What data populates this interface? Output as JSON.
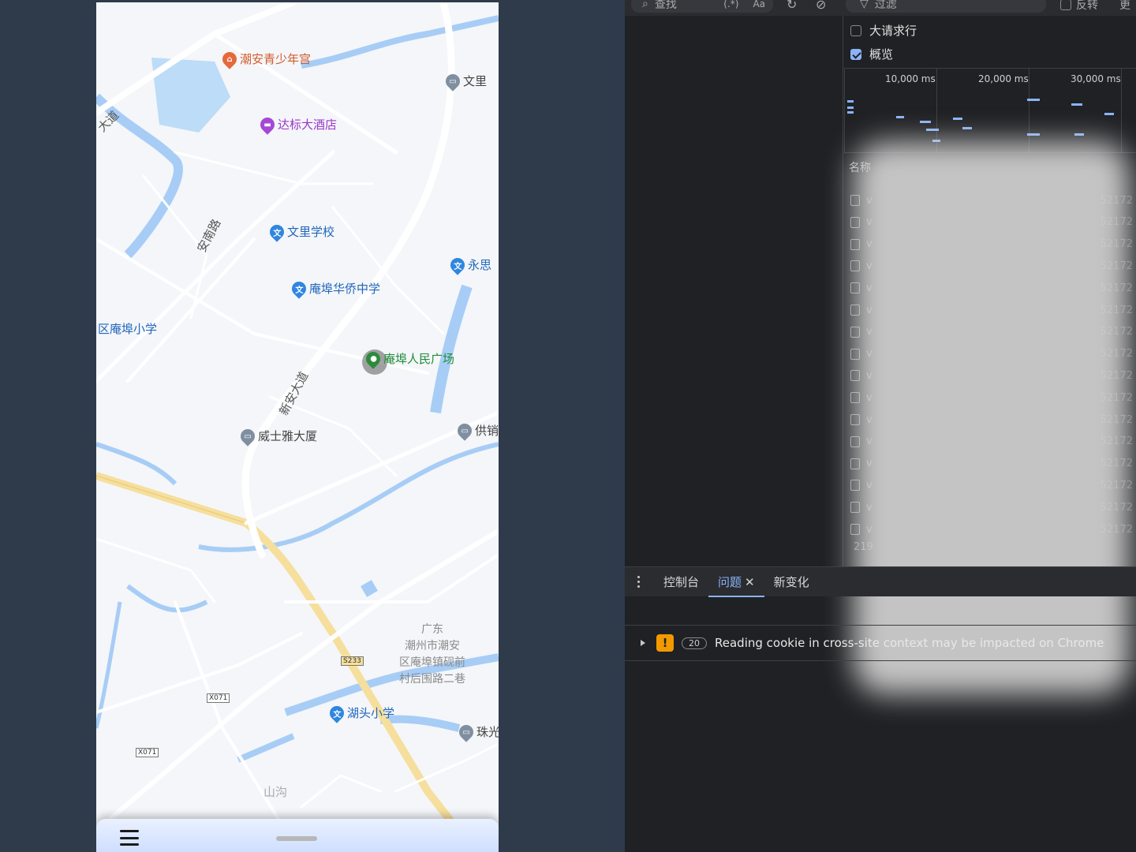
{
  "map": {
    "pois": [
      {
        "label": "潮安青少年宫",
        "color": "#d25b2e",
        "pin": "#e5693b",
        "glyph": "⌂",
        "icon": "palace-icon"
      },
      {
        "label": "达标大酒店",
        "color": "#9b36c9",
        "pin": "#a647d6",
        "glyph": "▬",
        "icon": "hotel-icon"
      },
      {
        "label": "文里",
        "color": "#444",
        "pin": "#7f8fa0",
        "glyph": "▭",
        "icon": "building-icon"
      },
      {
        "label": "文里学校",
        "color": "#2266bb",
        "pin": "#2f86e0",
        "glyph": "文",
        "icon": "school-icon"
      },
      {
        "label": "永思",
        "color": "#2266bb",
        "pin": "#2f86e0",
        "glyph": "文",
        "icon": "school-icon"
      },
      {
        "label": "庵埠华侨中学",
        "color": "#2266bb",
        "pin": "#2f86e0",
        "glyph": "文",
        "icon": "school-icon"
      },
      {
        "label": "区庵埠小学",
        "color": "#2266bb",
        "pin": "",
        "glyph": "",
        "icon": ""
      },
      {
        "label": "庵埠人民广场",
        "color": "#218c3a",
        "pin": "#2d8a3d",
        "glyph": "●",
        "icon": "park-icon"
      },
      {
        "label": "供销",
        "color": "#444",
        "pin": "#7f8fa0",
        "glyph": "▭",
        "icon": "building-icon"
      },
      {
        "label": "威士雅大厦",
        "color": "#444",
        "pin": "#7f8fa0",
        "glyph": "▭",
        "icon": "building-icon"
      },
      {
        "label": "湖头小学",
        "color": "#2266bb",
        "pin": "#2f86e0",
        "glyph": "文",
        "icon": "school-icon"
      },
      {
        "label": "珠光",
        "color": "#444",
        "pin": "#7f8fa0",
        "glyph": "▭",
        "icon": "building-icon"
      }
    ],
    "road_labels": [
      "大道",
      "安南路",
      "新安大道",
      "山沟"
    ],
    "area_label": "广东\n潮州市潮安\n区庵埠镇砚前\n村后围路二巷",
    "shields": [
      "S233",
      "X071",
      "X071"
    ]
  },
  "devtools": {
    "toolbar": {
      "search_placeholder": "查找",
      "regex_label": "(.*)",
      "case_label": "Aa",
      "filter_placeholder": "过滤",
      "invert_label": "反转",
      "more_label": "更"
    },
    "options": {
      "large_rows": "大请求行",
      "overview": "概览"
    },
    "timeline_ticks": [
      "10,000 ms",
      "20,000 ms",
      "30,000 ms"
    ],
    "network": {
      "column_name": "名称",
      "row_prefix": "v",
      "row_suffix": "52172",
      "status": "219"
    },
    "drawer": {
      "tabs": [
        "控制台",
        "问题",
        "新变化"
      ],
      "active_tab": "问题"
    },
    "issue": {
      "count": "20",
      "text": "Reading cookie in cross-site context may be impacted on Chrome"
    }
  }
}
